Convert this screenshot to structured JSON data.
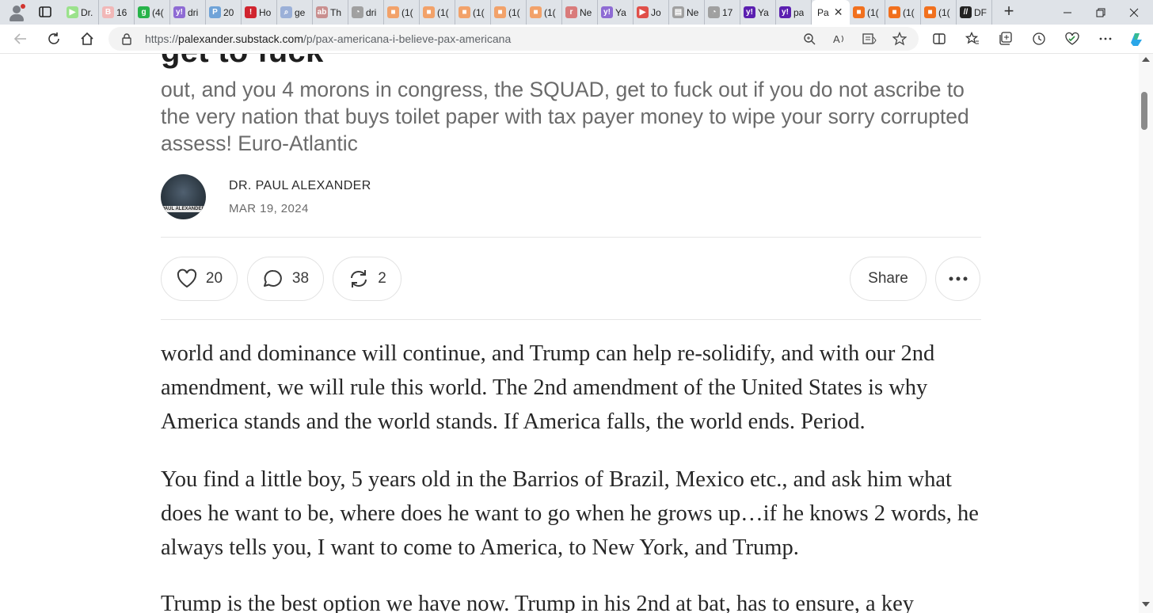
{
  "browser": {
    "tabs": [
      {
        "title": "Dr.",
        "fav": "▶",
        "color": "#9be28c"
      },
      {
        "title": "16",
        "fav": "B",
        "color": "#f1b8b8"
      },
      {
        "title": "(4(",
        "fav": "g",
        "color": "#27b34a"
      },
      {
        "title": "dri",
        "fav": "y!",
        "color": "#8e6bd4"
      },
      {
        "title": "20",
        "fav": "P",
        "color": "#6fa3d8"
      },
      {
        "title": "Ho",
        "fav": "!",
        "color": "#d0242f"
      },
      {
        "title": "ge",
        "fav": "⌕",
        "color": "#9bb0d8"
      },
      {
        "title": "Th",
        "fav": "ab",
        "color": "#c98f8f"
      },
      {
        "title": "dri",
        "fav": "◔",
        "color": "#a0a0a0"
      },
      {
        "title": "(1(",
        "fav": "■",
        "color": "#f2a26a"
      },
      {
        "title": "(1(",
        "fav": "■",
        "color": "#f2a26a"
      },
      {
        "title": "(1(",
        "fav": "■",
        "color": "#f2a26a"
      },
      {
        "title": "(1(",
        "fav": "■",
        "color": "#f2a26a"
      },
      {
        "title": "(1(",
        "fav": "■",
        "color": "#f2a26a"
      },
      {
        "title": "Ne",
        "fav": "r",
        "color": "#d97b7b"
      },
      {
        "title": "Ya",
        "fav": "y!",
        "color": "#8e6bd4"
      },
      {
        "title": "Jo",
        "fav": "▶",
        "color": "#e0504a"
      },
      {
        "title": "Ne",
        "fav": "▤",
        "color": "#a0a0a0"
      },
      {
        "title": "17",
        "fav": "◔",
        "color": "#a0a0a0"
      },
      {
        "title": "Ya",
        "fav": "y!",
        "color": "#5b1fb0"
      },
      {
        "title": "pa",
        "fav": "y!",
        "color": "#5b1fb0"
      }
    ],
    "active_tab": {
      "title": "Pa",
      "close": "✕"
    },
    "tabs_after": [
      {
        "title": "(1(",
        "fav": "■",
        "color": "#f1701e"
      },
      {
        "title": "(1(",
        "fav": "■",
        "color": "#f1701e"
      },
      {
        "title": "(1(",
        "fav": "■",
        "color": "#f1701e"
      },
      {
        "title": "DF",
        "fav": "//",
        "color": "#222222"
      }
    ],
    "new_tab": "+",
    "url_prefix": "https://",
    "url_host": "palexander.substack.com",
    "url_path": "/p/pax-americana-i-believe-pax-americana"
  },
  "article": {
    "title_fragment": "get to fuck",
    "subtitle": "out, and you 4 morons in congress, the SQUAD, get to fuck out if you do not ascribe to the very nation that buys toilet paper with tax payer money to wipe your sorry corrupted assess! Euro-Atlantic",
    "avatar_caption": "PAUL ALEXANDER",
    "author": "DR. PAUL ALEXANDER",
    "date": "MAR 19, 2024",
    "likes": "20",
    "comments": "38",
    "restacks": "2",
    "share_label": "Share",
    "paragraphs": [
      "world and dominance will continue, and Trump can help re-solidify, and with our 2nd amendment, we will rule this world. The 2nd amendment of the United States is why America stands and the world stands. If America falls, the world ends. Period.",
      "You find a little boy, 5 years old in the Barrios of Brazil, Mexico etc., and ask him what does he want to be, where does he want to go when he grows up…if he knows 2 words, he always tells you, I want to come to America, to New York, and Trump.",
      "Trump is the best option we have now. Trump in his 2nd at bat, has to ensure, a key"
    ]
  }
}
